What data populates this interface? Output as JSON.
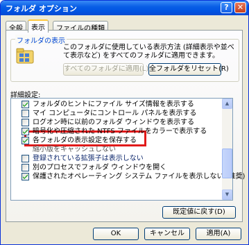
{
  "window": {
    "title": "フォルダ オプション",
    "help_glyph": "?",
    "close_glyph": "✕"
  },
  "tabs": [
    {
      "label": "全般"
    },
    {
      "label": "表示",
      "active": true
    },
    {
      "label": "ファイルの種類"
    }
  ],
  "folder_view": {
    "legend": "フォルダの表示",
    "description": "このフォルダに使用している表示方法 (詳細表示や並べて表示など) をすべてのフォルダに適用できます。",
    "apply_button": "すべてのフォルダに適用(L)",
    "reset_button": "全フォルダをリセット(R)"
  },
  "advanced": {
    "label": "詳細設定:",
    "items": [
      {
        "label": "フォルダのヒントにファイル サイズ情報を表示する",
        "checked": true
      },
      {
        "label": "マイ コンピュータにコントロール パネルを表示する",
        "checked": false
      },
      {
        "label": "ログオン時に以前のフォルダ ウィンドウを表示する",
        "checked": false
      },
      {
        "label": "暗号化や圧縮された NTFS ファイルをカラーで表示する",
        "checked": true
      },
      {
        "label": "各フォルダの表示設定を保存する",
        "checked": true
      },
      {
        "label": "縮小版をキャッシュしない",
        "checked": false
      },
      {
        "label": "登録されている拡張子は表示しない",
        "checked": false
      },
      {
        "label": "別のプロセスでフォルダ ウィンドウを開く",
        "checked": false
      },
      {
        "label": "保護されたオペレーティング システム ファイルを表示しない (推奨)",
        "checked": true
      }
    ]
  },
  "buttons": {
    "restore_defaults": "既定値に戻す(D)",
    "ok": "OK",
    "cancel": "キャンセル",
    "apply": "適用(A)"
  },
  "colors": {
    "highlight_border": "#e11a1a",
    "title_bar": "#0054e3"
  }
}
